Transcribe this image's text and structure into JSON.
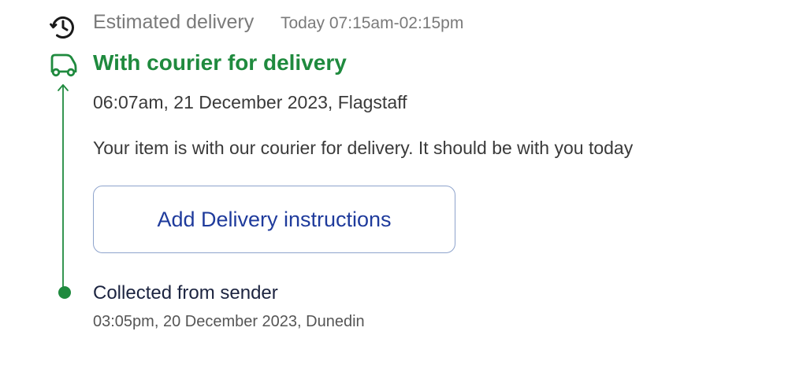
{
  "estimated_delivery": {
    "label": "Estimated delivery",
    "window": "Today 07:15am-02:15pm",
    "icon": "clock-icon"
  },
  "current_status": {
    "title": "With courier for delivery",
    "timestamp": "06:07am, 21 December 2023, Flagstaff",
    "description": "Your item is with our courier for delivery. It should be with you today",
    "icon": "truck-icon",
    "color": "#1f8a3e"
  },
  "actions": {
    "add_instructions_label": "Add Delivery instructions",
    "button_text_color": "#1f3b9c"
  },
  "history": [
    {
      "title": "Collected from sender",
      "timestamp": "03:05pm, 20 December 2023, Dunedin"
    }
  ]
}
